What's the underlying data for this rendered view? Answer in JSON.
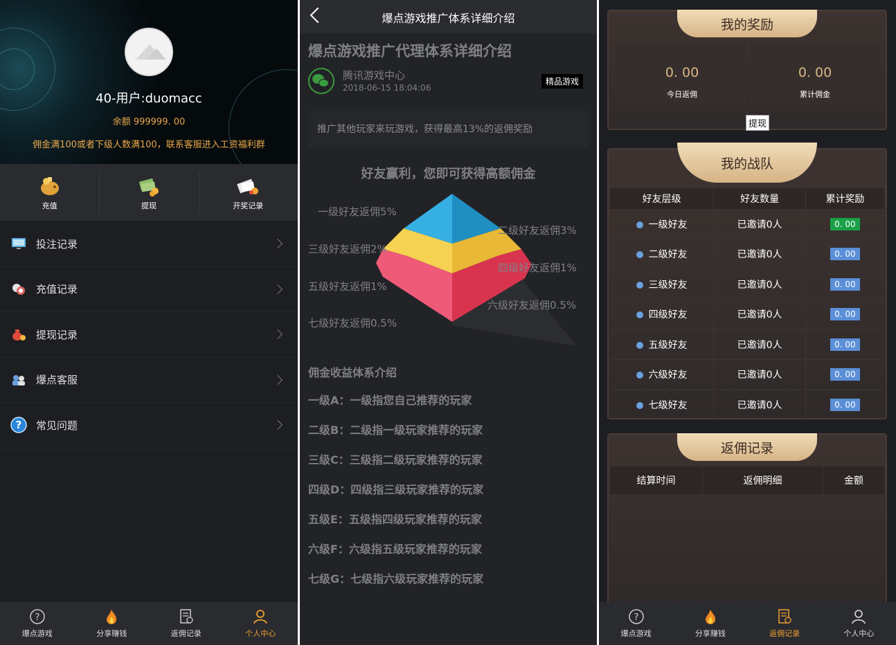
{
  "panel1": {
    "username": "40-用户:duomacc",
    "balance": "余额 999999. 00",
    "notice": "佣金满100或者下级人数满100，联系客服进入工资福利群",
    "quick": [
      {
        "label": "充值",
        "icon": "piggy-bank-icon"
      },
      {
        "label": "提现",
        "icon": "cash-icon"
      },
      {
        "label": "开奖记录",
        "icon": "ticket-icon"
      }
    ],
    "menu": [
      {
        "label": "投注记录",
        "icon": "monitor-icon"
      },
      {
        "label": "充值记录",
        "icon": "chips-icon"
      },
      {
        "label": "提现记录",
        "icon": "money-bag-icon"
      },
      {
        "label": "爆点客服",
        "icon": "support-icon"
      },
      {
        "label": "常见问题",
        "icon": "question-icon"
      }
    ],
    "tabs": [
      {
        "label": "爆点游戏",
        "icon": "question-circle-icon",
        "active": false
      },
      {
        "label": "分享赚钱",
        "icon": "fire-icon",
        "active": false
      },
      {
        "label": "返佣记录",
        "icon": "document-icon",
        "active": false
      },
      {
        "label": "个人中心",
        "icon": "user-icon",
        "active": true
      }
    ]
  },
  "panel2": {
    "nav_title": "爆点游戏推广体系详细介绍",
    "article_title": "爆点游戏推广代理体系详细介绍",
    "source": "腾讯游戏中心",
    "date": "2018-06-15 18:04:06",
    "tag": "精品游戏",
    "desc": "推广其他玩家来玩游戏，获得最高13%的返佣奖励",
    "subhead": "好友赢利，您即可获得高额佣金",
    "pyramid_labels": [
      "一级好友返佣5%",
      "二级好友返佣3%",
      "三级好友返佣2%",
      "四级好友返佣1%",
      "五级好友返佣1%",
      "六级好友返佣0.5%",
      "七级好友返佣0.5%"
    ],
    "section_title": "佣金收益体系介绍",
    "levels": [
      "一级A：一级指您自己推荐的玩家",
      "二级B：二级指一级玩家推荐的玩家",
      "三级C：三级指二级玩家推荐的玩家",
      "四级D：四级指三级玩家推荐的玩家",
      "五级E：五级指四级玩家推荐的玩家",
      "六级F：六级指五级玩家推荐的玩家",
      "七级G：七级指六级玩家推荐的玩家"
    ]
  },
  "panel3": {
    "reward_title": "我的奖励",
    "today_value": "0. 00",
    "today_label": "今日返佣",
    "total_value": "0. 00",
    "total_label": "累计佣金",
    "withdraw": "提现",
    "team_title": "我的战队",
    "team_headers": [
      "好友层级",
      "好友数量",
      "累计奖励"
    ],
    "team_rows": [
      {
        "level": "一级好友",
        "count": "已邀请0人",
        "reward": "0. 00"
      },
      {
        "level": "二级好友",
        "count": "已邀请0人",
        "reward": "0. 00"
      },
      {
        "level": "三级好友",
        "count": "已邀请0人",
        "reward": "0. 00"
      },
      {
        "level": "四级好友",
        "count": "已邀请0人",
        "reward": "0. 00"
      },
      {
        "level": "五级好友",
        "count": "已邀请0人",
        "reward": "0. 00"
      },
      {
        "level": "六级好友",
        "count": "已邀请0人",
        "reward": "0. 00"
      },
      {
        "level": "七级好友",
        "count": "已邀请0人",
        "reward": "0. 00"
      }
    ],
    "rebate_title": "返佣记录",
    "rebate_headers": [
      "结算时间",
      "返佣明细",
      "金额"
    ],
    "tabs": [
      {
        "label": "爆点游戏",
        "icon": "question-circle-icon",
        "active": false
      },
      {
        "label": "分享赚钱",
        "icon": "fire-icon",
        "active": false
      },
      {
        "label": "返佣记录",
        "icon": "document-icon",
        "active": true
      },
      {
        "label": "个人中心",
        "icon": "user-icon",
        "active": false
      }
    ]
  },
  "colors": {
    "accent_orange": "#f0a130",
    "gold": "#d7b787",
    "badge_green": "#1aa148",
    "badge_blue": "#5b8fd8"
  }
}
